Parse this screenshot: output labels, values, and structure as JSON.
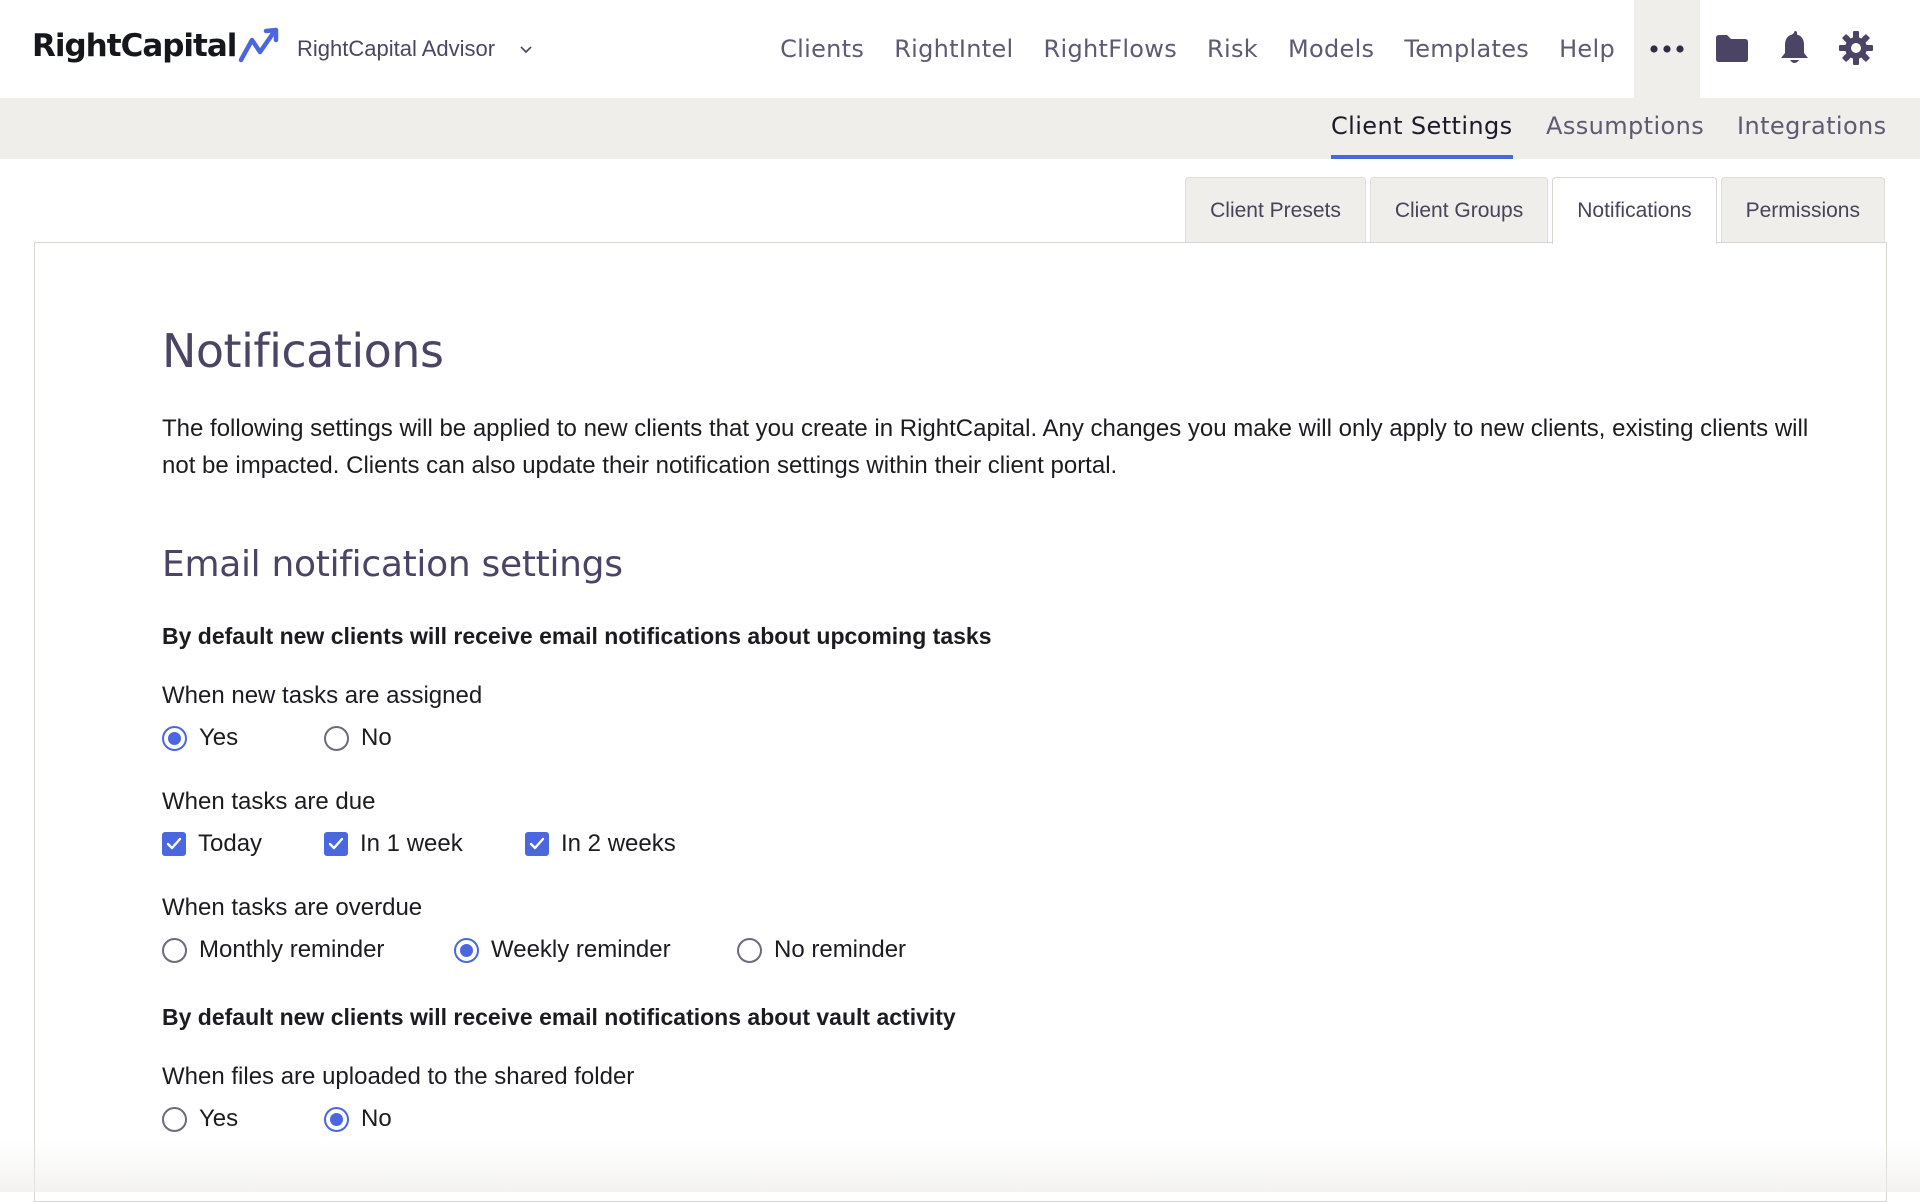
{
  "header": {
    "logo_text": "RightCapital",
    "advisor_label": "RightCapital Advisor",
    "nav": [
      "Clients",
      "RightIntel",
      "RightFlows",
      "Risk",
      "Models",
      "Templates",
      "Help"
    ],
    "more_label": "•••",
    "icons": [
      "folder-icon",
      "bell-icon",
      "gear-icon"
    ]
  },
  "subnav": {
    "items": [
      "Client Settings",
      "Assumptions",
      "Integrations"
    ],
    "active": "Client Settings"
  },
  "tabs": {
    "items": [
      "Client Presets",
      "Client Groups",
      "Notifications",
      "Permissions"
    ],
    "active": "Notifications"
  },
  "page": {
    "title": "Notifications",
    "intro": "The following settings will be applied to new clients that you create in RightCapital. Any changes you make will only apply to new clients, existing clients will not be impacted. Clients can also update their notification settings within their client portal.",
    "email_heading": "Email notification settings",
    "tasks_section": "By default new clients will receive email notifications about upcoming tasks",
    "new_tasks": {
      "label": "When new tasks are assigned",
      "options": [
        "Yes",
        "No"
      ],
      "selected": "Yes"
    },
    "tasks_due": {
      "label": "When tasks are due",
      "options": [
        "Today",
        "In 1 week",
        "In 2 weeks"
      ],
      "checked": [
        true,
        true,
        true
      ]
    },
    "overdue": {
      "label": "When tasks are overdue",
      "options": [
        "Monthly reminder",
        "Weekly reminder",
        "No reminder"
      ],
      "selected": "Weekly reminder"
    },
    "vault_section": "By default new clients will receive email notifications about vault activity",
    "files_uploaded": {
      "label": "When files are uploaded to the shared folder",
      "options": [
        "Yes",
        "No"
      ],
      "selected": "No"
    }
  },
  "colors": {
    "accent": "#4a67e0",
    "heading": "#4b4464",
    "subnav_bg": "#efeeea"
  }
}
